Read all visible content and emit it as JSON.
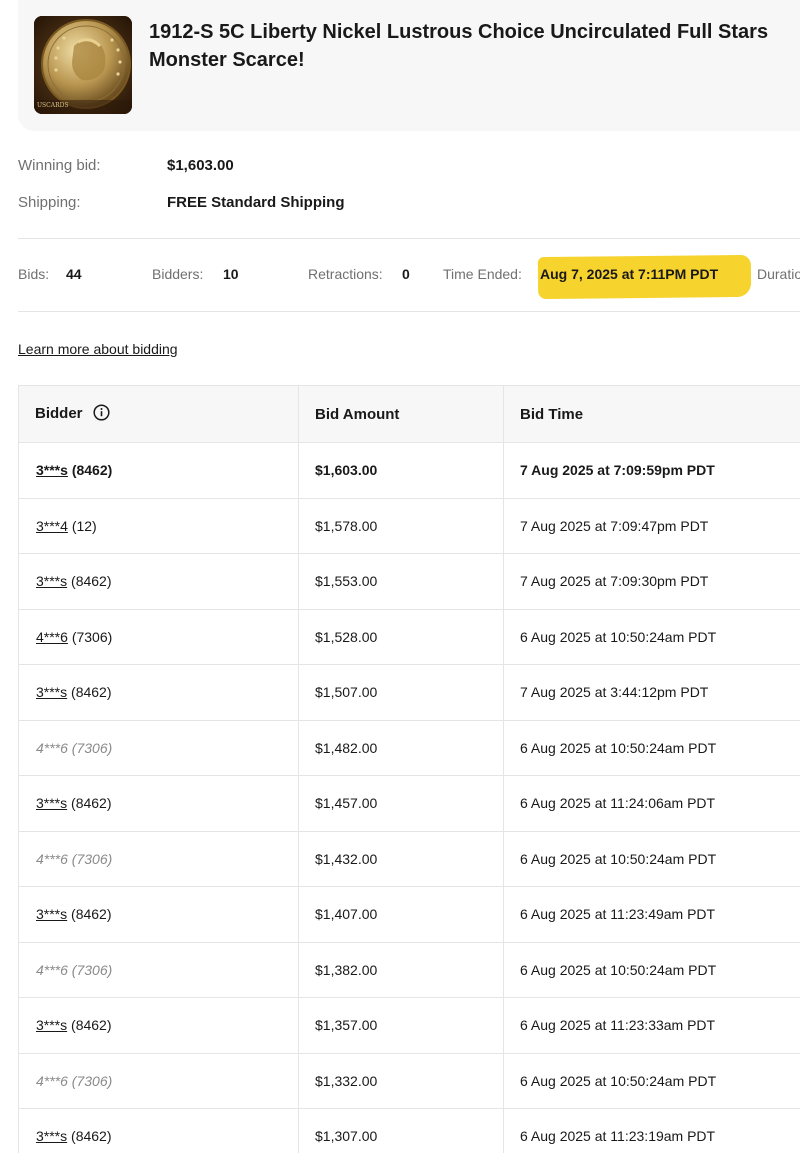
{
  "item": {
    "title": "1912-S 5C Liberty Nickel Lustrous Choice Uncirculated Full Stars Monster Scarce!",
    "thumb_watermark": "USCARDS"
  },
  "summary": {
    "winning_bid_label": "Winning bid:",
    "winning_bid_value": "$1,603.00",
    "shipping_label": "Shipping:",
    "shipping_value": "FREE Standard Shipping"
  },
  "stats": {
    "bids_label": "Bids:",
    "bids_value": "44",
    "bidders_label": "Bidders:",
    "bidders_value": "10",
    "retractions_label": "Retractions:",
    "retractions_value": "0",
    "time_ended_label": "Time Ended:",
    "time_ended_value": "Aug 7, 2025 at 7:11PM PDT",
    "duration_label": "Duratio",
    "highlight_color": "#f6d32d"
  },
  "learn_link": "Learn more about bidding",
  "table": {
    "headers": {
      "bidder": "Bidder",
      "amount": "Bid Amount",
      "time": "Bid Time"
    },
    "rows": [
      {
        "bidder": "3***s",
        "score": "(8462)",
        "amount": "$1,603.00",
        "time": "7 Aug 2025 at 7:09:59pm PDT"
      },
      {
        "bidder": "3***4",
        "score": "(12)",
        "amount": "$1,578.00",
        "time": "7 Aug 2025 at 7:09:47pm PDT"
      },
      {
        "bidder": "3***s",
        "score": "(8462)",
        "amount": "$1,553.00",
        "time": "7 Aug 2025 at 7:09:30pm PDT"
      },
      {
        "bidder": "4***6",
        "score": "(7306)",
        "amount": "$1,528.00",
        "time": "6 Aug 2025 at 10:50:24am PDT"
      },
      {
        "bidder": "3***s",
        "score": "(8462)",
        "amount": "$1,507.00",
        "time": "7 Aug 2025 at 3:44:12pm PDT"
      },
      {
        "bidder": "4***6 (7306)",
        "score": "",
        "amount": "$1,482.00",
        "time": "6 Aug 2025 at 10:50:24am PDT"
      },
      {
        "bidder": "3***s",
        "score": "(8462)",
        "amount": "$1,457.00",
        "time": "6 Aug 2025 at 11:24:06am PDT"
      },
      {
        "bidder": "4***6 (7306)",
        "score": "",
        "amount": "$1,432.00",
        "time": "6 Aug 2025 at 10:50:24am PDT"
      },
      {
        "bidder": "3***s",
        "score": "(8462)",
        "amount": "$1,407.00",
        "time": "6 Aug 2025 at 11:23:49am PDT"
      },
      {
        "bidder": "4***6 (7306)",
        "score": "",
        "amount": "$1,382.00",
        "time": "6 Aug 2025 at 10:50:24am PDT"
      },
      {
        "bidder": "3***s",
        "score": "(8462)",
        "amount": "$1,357.00",
        "time": "6 Aug 2025 at 11:23:33am PDT"
      },
      {
        "bidder": "4***6 (7306)",
        "score": "",
        "amount": "$1,332.00",
        "time": "6 Aug 2025 at 10:50:24am PDT"
      },
      {
        "bidder": "3***s",
        "score": "(8462)",
        "amount": "$1,307.00",
        "time": "6 Aug 2025 at 11:23:19am PDT"
      }
    ]
  }
}
